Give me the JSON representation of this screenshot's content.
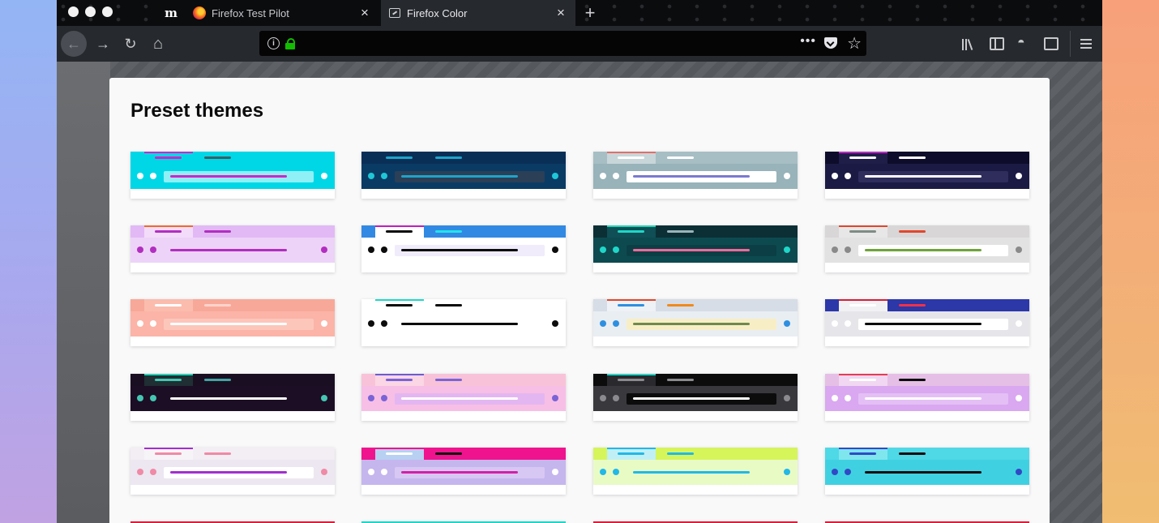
{
  "window": {
    "tabs": [
      {
        "title": "",
        "logo": "m",
        "icon": "medium-logo-icon"
      },
      {
        "title": "Firefox Test Pilot",
        "icon": "firefox-logo-icon"
      },
      {
        "title": "Firefox Color",
        "icon": "firefox-color-icon",
        "active": true
      }
    ],
    "new_tab_symbol": "+",
    "close_symbol": "×",
    "toolbar": {
      "back_symbol": "←",
      "forward_symbol": "→",
      "reload_symbol": "↻",
      "home_symbol": "⌂",
      "info_symbol": "i",
      "more_symbol": "•••",
      "star_symbol": "☆",
      "url_value": ""
    }
  },
  "page": {
    "title": "Preset themes"
  },
  "colors": {
    "lock": "#12bc00",
    "panel": "#f9f9fa"
  },
  "themes": [
    {
      "tab": "#00d7e6",
      "active": "#00d7e6",
      "accent": "#d026c8",
      "tbar1": "#d026c8",
      "tbar2": "#3b5f66",
      "nav": "#00d7e6",
      "dots": "#ffffff",
      "url": "#8ff0f6",
      "ubar": "#d026c8"
    },
    {
      "tab": "#0a2f56",
      "active": "#0a2f56",
      "accent": "#0a2f56",
      "tbar1": "#1fa3c9",
      "tbar2": "#1fa3c9",
      "nav": "#0a3b64",
      "dots": "#1fc6d6",
      "url": "#2b3f56",
      "ubar": "#1fa3c9"
    },
    {
      "tab": "#a6bec4",
      "active": "#c8d6d9",
      "accent": "#e0706b",
      "tbar1": "#ffffff",
      "tbar2": "#ffffff",
      "nav": "#98b3b9",
      "dots": "#ffffff",
      "url": "#ffffff",
      "ubar": "#7a7ad0"
    },
    {
      "tab": "#0d0c2a",
      "active": "#1f1e48",
      "accent": "#c026c6",
      "tbar1": "#ffffff",
      "tbar2": "#ffffff",
      "nav": "#1b1a44",
      "dots": "#ffffff",
      "url": "#2e2d5c",
      "ubar": "#ffffff"
    },
    {
      "tab": "#e2b9f5",
      "active": "#f3dcfa",
      "accent": "#f06a2c",
      "tbar1": "#b22ec0",
      "tbar2": "#b22ec0",
      "nav": "#edd3f8",
      "dots": "#b22ec0",
      "url": "#edd3f8",
      "ubar": "#b22ec0"
    },
    {
      "tab": "#3189e3",
      "active": "#ffffff",
      "accent": "#c41ec1",
      "tbar1": "#0c0c0d",
      "tbar2": "#22e3e8",
      "nav": "#ffffff",
      "dots": "#0c0c0d",
      "url": "#f0ecfb",
      "ubar": "#0c0c0d"
    },
    {
      "tab": "#0b2f35",
      "active": "#0f4f55",
      "accent": "#1fd7b7",
      "tbar1": "#1fd7c8",
      "tbar2": "#9ab4bb",
      "nav": "#0d4a50",
      "dots": "#1fd7c8",
      "url": "#0b3f45",
      "ubar": "#f06a9a"
    },
    {
      "tab": "#d8d6d6",
      "active": "#e8e7e7",
      "accent": "#e0472c",
      "tbar1": "#7f8c86",
      "tbar2": "#e0472c",
      "nav": "#e3e2e2",
      "dots": "#8a8a8a",
      "url": "#ffffff",
      "ubar": "#6ea33a"
    },
    {
      "tab": "#f8a898",
      "active": "#fbbcae",
      "accent": "#fbbcae",
      "tbar1": "#ffffff",
      "tbar2": "#ffd3cb",
      "nav": "#fbb4a7",
      "dots": "#ffffff",
      "url": "#fcc6bb",
      "ubar": "#ffffff"
    },
    {
      "tab": "#ffffff",
      "active": "#ffffff",
      "accent": "#1fd7c8",
      "tbar1": "#0c0c0d",
      "tbar2": "#0c0c0d",
      "nav": "#ffffff",
      "dots": "#0c0c0d",
      "url": "#ffffff",
      "ubar": "#0c0c0d"
    },
    {
      "tab": "#d6dde6",
      "active": "#eef2f6",
      "accent": "#e0472c",
      "tbar1": "#2e8fe0",
      "tbar2": "#f08a1c",
      "nav": "#e9eef3",
      "dots": "#2e8fe0",
      "url": "#f8eec6",
      "ubar": "#6e8a4e"
    },
    {
      "tab": "#2c37a8",
      "active": "#f1f1f4",
      "accent": "#d51f3c",
      "tbar1": "#ffffff",
      "tbar2": "#f0304a",
      "nav": "#e6e6ea",
      "dots": "#ffffff",
      "url": "#ffffff",
      "ubar": "#0c0c0d"
    },
    {
      "tab": "#1a0f22",
      "active": "#1f2f33",
      "accent": "#22d3b7",
      "tbar1": "#44c6b3",
      "tbar2": "#44a3a3",
      "nav": "#1c0e24",
      "dots": "#44c6b3",
      "url": "#1c0e24",
      "ubar": "#ffffff"
    },
    {
      "tab": "#f8c3d8",
      "active": "#fbd6e4",
      "accent": "#6c5bd0",
      "tbar1": "#7a63d6",
      "tbar2": "#7a63d6",
      "nav": "#f7bfe6",
      "dots": "#7a63d6",
      "url": "#e3b6f2",
      "ubar": "#ffffff"
    },
    {
      "tab": "#0c0c0d",
      "active": "#2a2a2e",
      "accent": "#1fd7c8",
      "tbar1": "#8a8a8f",
      "tbar2": "#8a8a8f",
      "nav": "#38383d",
      "dots": "#8a8a8f",
      "url": "#0c0c0d",
      "ubar": "#ffffff"
    },
    {
      "tab": "#e6bfe6",
      "active": "#f1d7f1",
      "accent": "#e53c56",
      "tbar1": "#ffffff",
      "tbar2": "#0c0c0d",
      "nav": "#d9a8f0",
      "dots": "#ffffff",
      "url": "#e4bff5",
      "ubar": "#ffffff"
    },
    {
      "tab": "#f2eef4",
      "active": "#f7f4f8",
      "accent": "#a22ed0",
      "tbar1": "#f08aa6",
      "tbar2": "#f08aa6",
      "nav": "#ece7f0",
      "dots": "#f08aa6",
      "url": "#ffffff",
      "ubar": "#a22ed0"
    },
    {
      "tab": "#f0138e",
      "active": "#b8d0f2",
      "accent": "#f0138e",
      "tbar1": "#ffffff",
      "tbar2": "#0c0c0d",
      "nav": "#c5b6ee",
      "dots": "#ffffff",
      "url": "#d7c7f3",
      "ubar": "#d51fa7"
    },
    {
      "tab": "#d6f55a",
      "active": "#c0f0f5",
      "accent": "#22b8e8",
      "tbar1": "#22b8e8",
      "tbar2": "#22b8e8",
      "nav": "#e8fbc5",
      "dots": "#22b8e8",
      "url": "#e8fbc5",
      "ubar": "#22b8e8"
    },
    {
      "tab": "#4fd8e6",
      "active": "#7fe6ee",
      "accent": "#3149c6",
      "tbar1": "#3149c6",
      "tbar2": "#0c0c0d",
      "nav": "#3fd1e2",
      "dots": "#3149c6",
      "url": "#3fd1e2",
      "ubar": "#0c0c0d"
    }
  ]
}
